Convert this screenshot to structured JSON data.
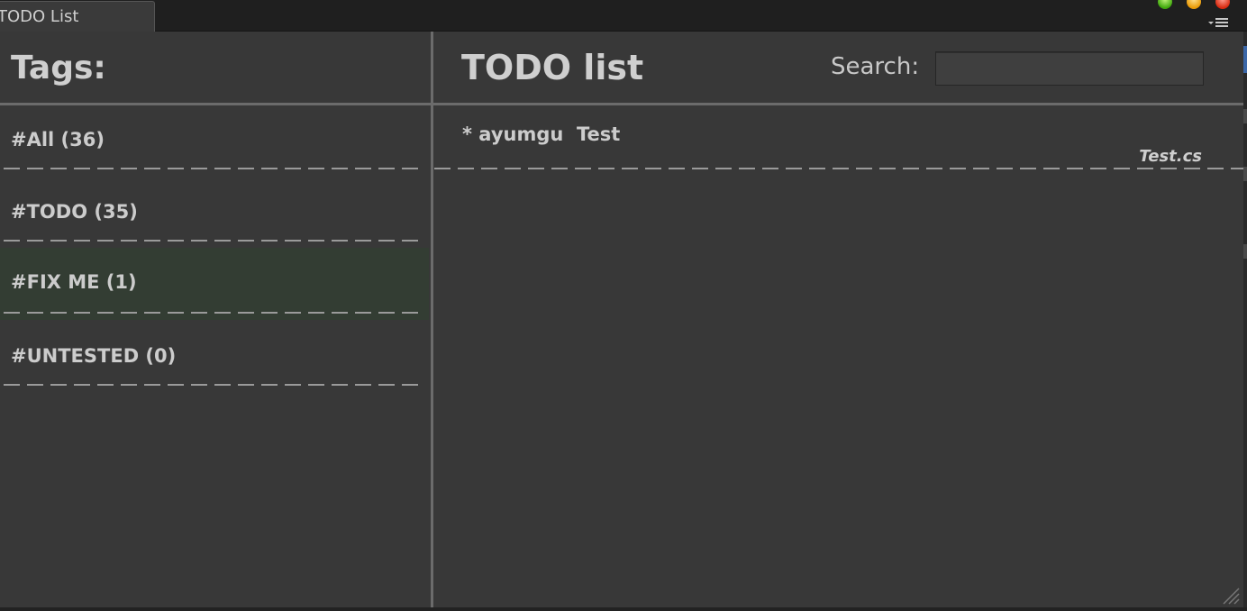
{
  "window": {
    "tab_title": "TODO List"
  },
  "tags_panel": {
    "title": "Tags:",
    "items": [
      {
        "label": "#All (36)"
      },
      {
        "label": "#TODO (35)"
      },
      {
        "label": "#FIX ME (1)"
      },
      {
        "label": "#UNTESTED (0)"
      }
    ],
    "selected_index": 2
  },
  "todo_panel": {
    "title": "TODO list",
    "search": {
      "label": "Search:",
      "value": "",
      "placeholder": ""
    },
    "items": [
      {
        "text": "* ayumgu  Test",
        "file": "Test.cs"
      }
    ]
  },
  "colors": {
    "background": "#383838",
    "selected_row": "#333d33",
    "divider": "#6b6b6b",
    "text": "#cccccc"
  },
  "icons": [
    "green-maximize-icon",
    "yellow-minimize-icon",
    "red-close-icon",
    "panel-menu-icon",
    "resize-grip-icon"
  ]
}
